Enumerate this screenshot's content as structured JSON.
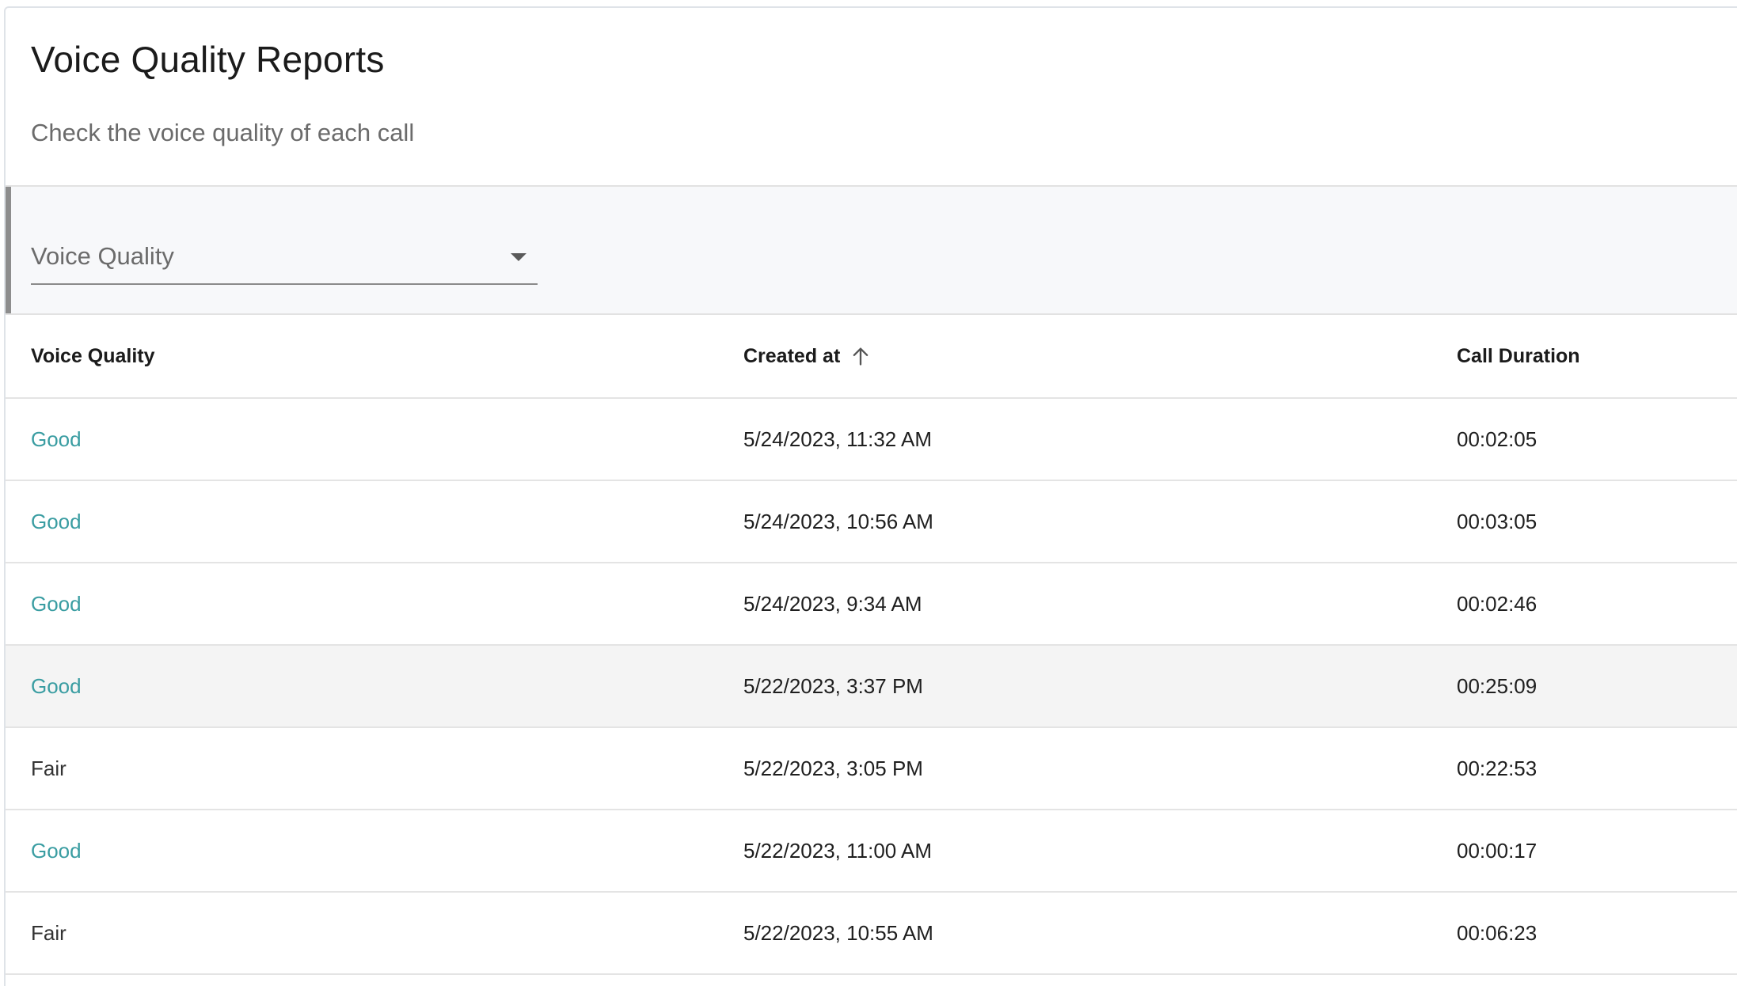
{
  "header": {
    "title": "Voice Quality Reports",
    "subtitle": "Check the voice quality of each call"
  },
  "filters": {
    "voice_quality_label": "Voice Quality",
    "dropdown_icon": "chevron-down-icon"
  },
  "table": {
    "columns": [
      "Voice Quality",
      "Created at",
      "Call Duration"
    ],
    "sort": {
      "column": "Created at",
      "direction": "ascending",
      "icon": "arrow-up-icon"
    },
    "rows": [
      {
        "quality": "Good",
        "created_at": "5/24/2023, 11:32 AM",
        "duration": "00:02:05"
      },
      {
        "quality": "Good",
        "created_at": "5/24/2023, 10:56 AM",
        "duration": "00:03:05"
      },
      {
        "quality": "Good",
        "created_at": "5/24/2023, 9:34 AM",
        "duration": "00:02:46"
      },
      {
        "quality": "Good",
        "created_at": "5/22/2023, 3:37 PM",
        "duration": "00:25:09"
      },
      {
        "quality": "Fair",
        "created_at": "5/22/2023, 3:05 PM",
        "duration": "00:22:53"
      },
      {
        "quality": "Good",
        "created_at": "5/22/2023, 11:00 AM",
        "duration": "00:00:17"
      },
      {
        "quality": "Fair",
        "created_at": "5/22/2023, 10:55 AM",
        "duration": "00:06:23"
      }
    ]
  },
  "colors": {
    "good": "#3a9da2",
    "fair": "#333333",
    "hover_row": "#f4f4f4",
    "filter_bar": "#f7f8fa"
  }
}
